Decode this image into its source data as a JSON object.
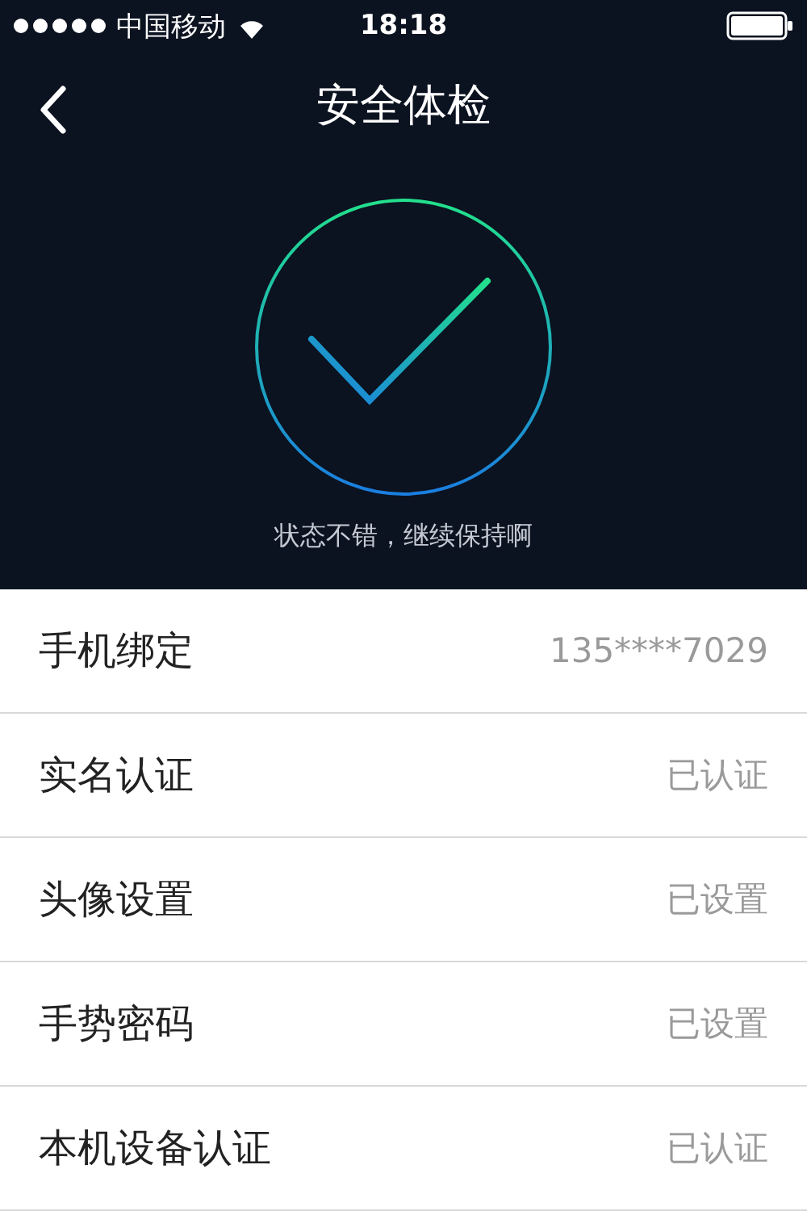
{
  "status_bar": {
    "carrier": "中国移动",
    "time": "18:18"
  },
  "nav": {
    "title": "安全体检"
  },
  "result": {
    "message": "状态不错，继续保持啊"
  },
  "items": [
    {
      "label": "手机绑定",
      "value": "135****7029"
    },
    {
      "label": "实名认证",
      "value": "已认证"
    },
    {
      "label": "头像设置",
      "value": "已设置"
    },
    {
      "label": "手势密码",
      "value": "已设置"
    },
    {
      "label": "本机设备认证",
      "value": "已认证"
    }
  ]
}
